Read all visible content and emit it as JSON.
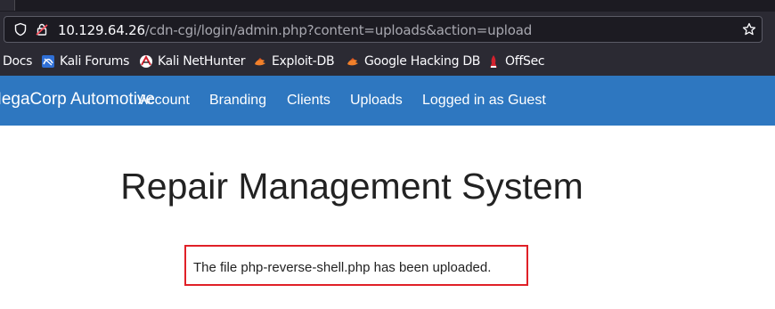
{
  "browser": {
    "url_host": "10.129.64.26",
    "url_path": "/cdn-cgi/login/admin.php?content=uploads&action=upload",
    "bookmarks": [
      {
        "label": "Docs",
        "icon": "none"
      },
      {
        "label": "Kali Forums",
        "icon": "kali-forums-icon"
      },
      {
        "label": "Kali NetHunter",
        "icon": "nethunter-icon"
      },
      {
        "label": "Exploit-DB",
        "icon": "exploit-db-icon"
      },
      {
        "label": "Google Hacking DB",
        "icon": "ghdb-icon"
      },
      {
        "label": "OffSec",
        "icon": "offsec-icon"
      }
    ]
  },
  "navbar": {
    "brand": "MegaCorp Automotive",
    "items": [
      "Account",
      "Branding",
      "Clients",
      "Uploads",
      "Logged in as Guest"
    ],
    "color": "#2e77c0"
  },
  "main": {
    "title": "Repair Management System",
    "message": "The file php-reverse-shell.php has been uploaded.",
    "message_border_color": "#e02027"
  }
}
